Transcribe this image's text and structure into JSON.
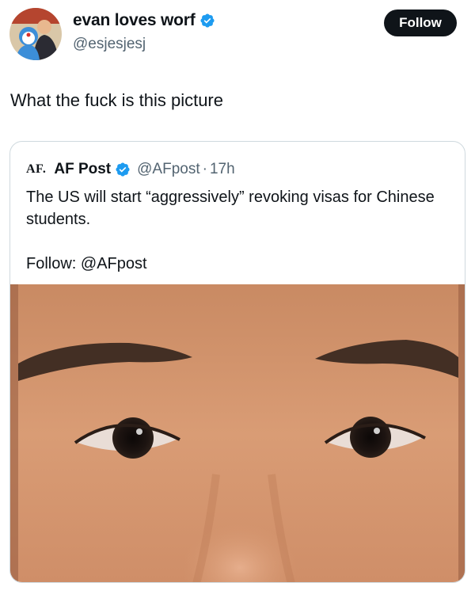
{
  "author": {
    "display_name": "evan loves worf",
    "handle": "@esjesjesj",
    "verified_icon": "verified-badge-icon",
    "avatar_icon": "profile-avatar"
  },
  "follow_button": {
    "label": "Follow"
  },
  "tweet": {
    "text": "What the fuck is this picture"
  },
  "quote": {
    "logo_text": "AF.",
    "name": "AF Post",
    "handle": "@AFpost",
    "separator": "·",
    "time": "17h",
    "text": "The US will start “aggressively” revoking visas for Chinese students.",
    "follow_line": "Follow: @AFpost",
    "image_icon": "face-closeup-photo"
  },
  "colors": {
    "text_primary": "#0f1419",
    "text_secondary": "#536471",
    "verified": "#1d9bf0",
    "border": "#cfd9de",
    "button_bg": "#0f1419"
  }
}
